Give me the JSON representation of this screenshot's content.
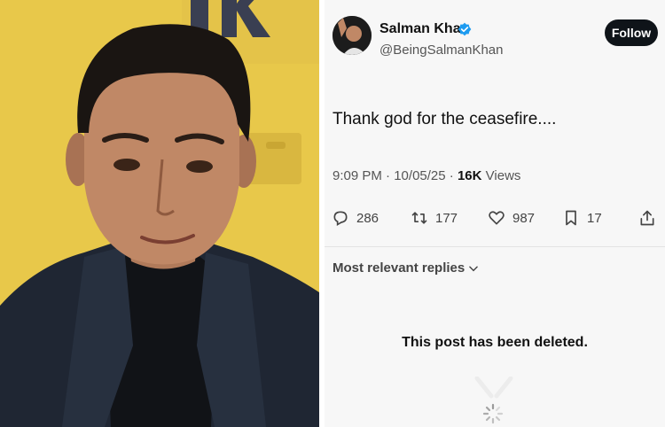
{
  "tweet": {
    "author_name": "Salman Khan",
    "author_handle": "@BeingSalmanKhan",
    "follow_label": "Follow",
    "text": "Thank god for the ceasefire....",
    "time": "9:09 PM",
    "date": "10/05/25",
    "views_count": "16K",
    "views_label": "Views"
  },
  "actions": {
    "replies": "286",
    "reposts": "177",
    "likes": "987",
    "bookmarks": "17"
  },
  "replies_section": {
    "sort_label": "Most relevant replies",
    "deleted_message": "This post has been deleted."
  },
  "icons": {
    "verified": "verified-badge-icon",
    "reply": "reply-icon",
    "repost": "repost-icon",
    "like": "heart-icon",
    "bookmark": "bookmark-icon",
    "share": "share-icon",
    "chevron": "chevron-down-icon",
    "loader": "loading-spinner-icon"
  },
  "colors": {
    "verified_blue": "#1d9bf0",
    "follow_bg": "#0f1419"
  }
}
